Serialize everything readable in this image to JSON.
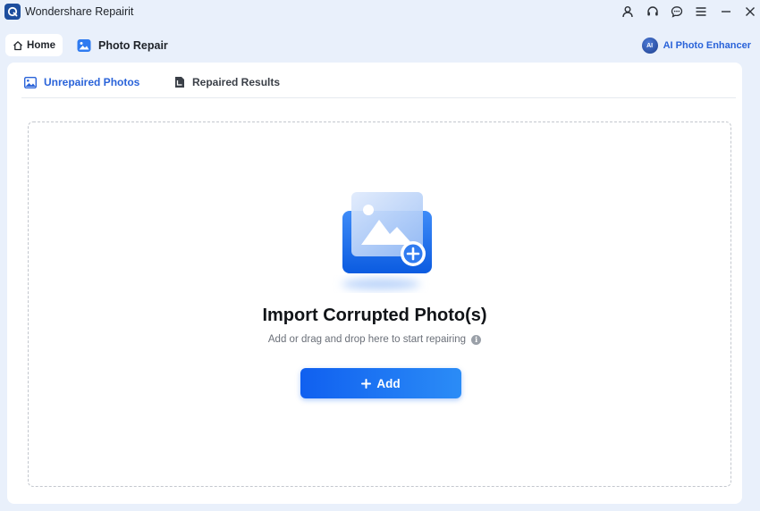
{
  "window": {
    "app_title": "Wondershare Repairit",
    "controls": [
      "account-icon",
      "headset-icon",
      "chat-icon",
      "menu-icon",
      "minimize-icon",
      "close-icon"
    ]
  },
  "nav": {
    "home_label": "Home",
    "section_title": "Photo Repair",
    "ai_badge": "AI",
    "ai_label": "AI Photo Enhancer"
  },
  "tabs": [
    {
      "label": "Unrepaired Photos",
      "active": true
    },
    {
      "label": "Repaired Results",
      "active": false
    }
  ],
  "dropzone": {
    "title": "Import Corrupted Photo(s)",
    "subtitle": "Add or drag and drop here to start repairing",
    "info_glyph": "i",
    "add_label": "Add"
  },
  "colors": {
    "accent": "#2a63d9",
    "background": "#e9f0fb",
    "button_start": "#1060f0",
    "button_end": "#2b8cf6"
  }
}
